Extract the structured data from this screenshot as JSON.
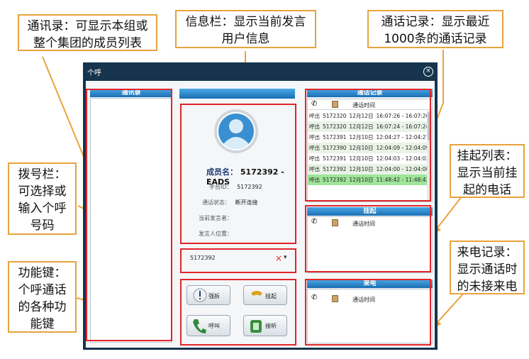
{
  "callouts": {
    "contacts": "通讯录：可显示本组或\n整个集团的成员列表",
    "info": "信息栏：显示当前发言\n用户信息",
    "call_log": "通话记录：显示最近\n1000条的通话记录",
    "dial": "拨号栏：\n可选择或\n输入个呼\n号码",
    "hold": "挂起列表：\n显示当前挂\n起的电话",
    "functions": "功能键：\n个呼通话\n的各种功\n能键",
    "incoming": "来电记录：\n显示通话时\n的未接来电"
  },
  "window": {
    "title": "个呼",
    "contacts_header": "通讯录",
    "call_log_header": "通话记录",
    "hold_header": "挂起",
    "incoming_header": "来电",
    "time_col": "通话时间"
  },
  "member": {
    "name_label": "成员名：",
    "name_value": "5172392 - EADS",
    "id_label": "手台ID：",
    "id_value": "5172392",
    "status_label": "通话状态：",
    "status_value": "断开连接",
    "speaker_label": "当前发言者：",
    "location_label": "发言人位置："
  },
  "dial": {
    "value": "5172392",
    "clear": "×",
    "arrow": "▾"
  },
  "buttons": {
    "force": "强拆",
    "hold": "挂起",
    "call": "呼叫",
    "answer": "接听"
  },
  "calls": [
    {
      "type": "呼出",
      "num": "5172320",
      "date": "12月12日",
      "time": "16:07:26 - 16:07:26"
    },
    {
      "type": "呼出",
      "num": "5172320",
      "date": "12月12日",
      "time": "16:07:24 - 16:07:24"
    },
    {
      "type": "呼出",
      "num": "5172391",
      "date": "12月10日",
      "time": "12:04:27 - 12:04:27"
    },
    {
      "type": "呼出",
      "num": "5172390",
      "date": "12月10日",
      "time": "12:04:09 - 12:04:09"
    },
    {
      "type": "呼出",
      "num": "5172391",
      "date": "12月10日",
      "time": "12:04:03 - 12:04:03"
    },
    {
      "type": "呼出",
      "num": "5172392",
      "date": "12月10日",
      "time": "12:04:00 - 12:04:00"
    },
    {
      "type": "呼出",
      "num": "5172392",
      "date": "12月10日",
      "time": "11:48:42 - 11:48:42"
    }
  ],
  "colors": {
    "arrow": "#e8a33d",
    "highlight": "#e0262a",
    "selected_row": "#9fe59a"
  }
}
